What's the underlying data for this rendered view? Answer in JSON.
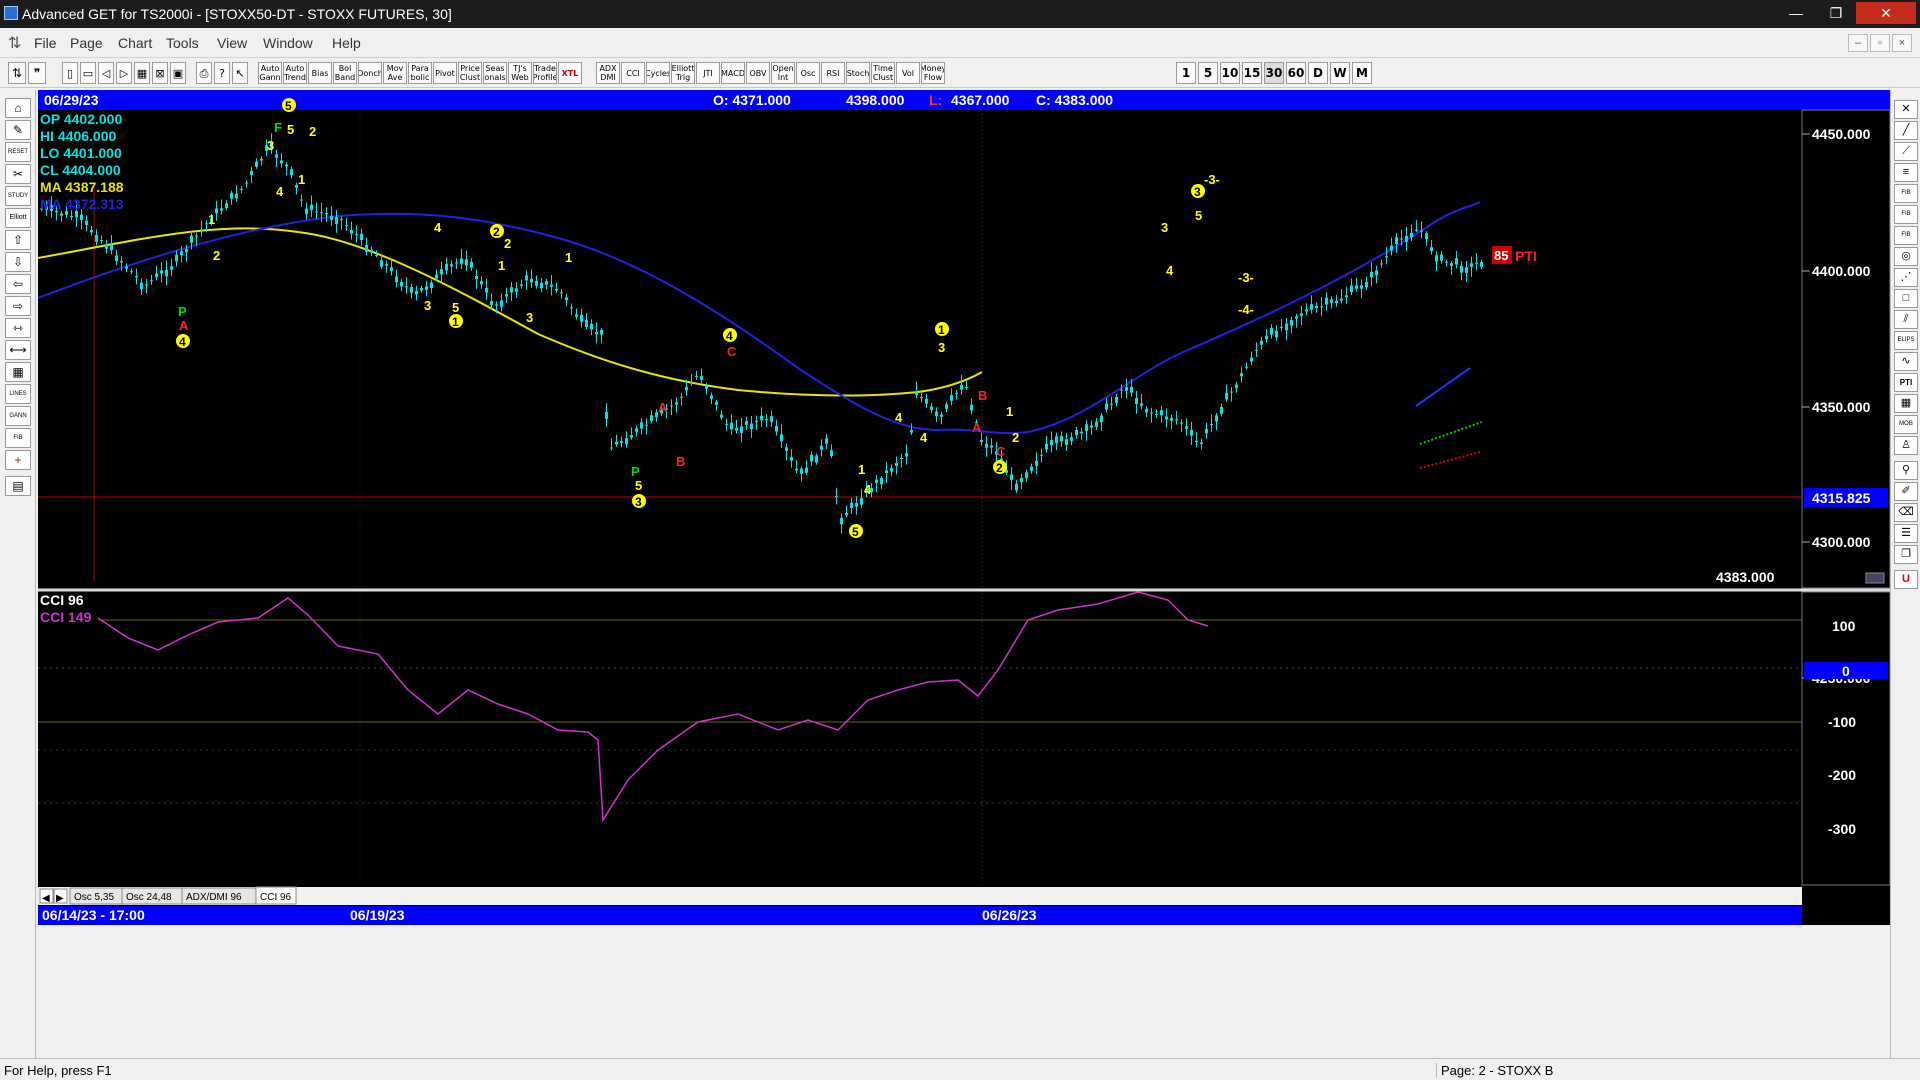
{
  "window": {
    "title": "Advanced GET for TS2000i - [STOXX50-DT - STOXX FUTURES, 30]",
    "buttons": [
      "—",
      "❐",
      "✕"
    ]
  },
  "menu": {
    "items": [
      "File",
      "Page",
      "Chart",
      "Tools",
      "View",
      "Window",
      "Help"
    ],
    "mdi_buttons": [
      "–",
      "▫",
      "×"
    ]
  },
  "toolbar": {
    "study_buttons": [
      "Auto Gann",
      "Auto Trend",
      "Bias",
      "Bol Band",
      "Donch",
      "Mov Ave",
      "Para bolic",
      "Pivot",
      "Price Clust",
      "Seas onals",
      "TJ's Web",
      "Trade Profile",
      "XTL",
      "ADX DMI",
      "CCI",
      "Cycles",
      "Elliott Trig",
      "JTI",
      "MACD",
      "OBV",
      "Open Int",
      "Osc",
      "RSI",
      "Stoch",
      "Time Clust",
      "Vol",
      "Money Flow"
    ],
    "interval_buttons": [
      "1",
      "5",
      "10",
      "15",
      "30",
      "60",
      "D",
      "W",
      "M"
    ]
  },
  "header": {
    "date": "06/29/23",
    "ohlc_open": "O: 4371.000",
    "ohlc_high": "4398.000",
    "ohlc_low_prefix": "L:",
    "ohlc_low": "4367.000",
    "ohlc_close": "C: 4383.000"
  },
  "legend": {
    "op": "OP  4402.000",
    "hi": "HI   4406.000",
    "lo": "LO  4401.000",
    "cl": "CL  4404.000",
    "ma1": "MA  4387.188",
    "ma2": "MA  4372.313"
  },
  "price_axis": {
    "ticks": [
      "4450.000",
      "4400.000",
      "4350.000",
      "4300.000",
      "4250.000"
    ],
    "current_line": "4315.825",
    "last_price": "4383.000"
  },
  "pti": {
    "value": "85",
    "label": "PTI"
  },
  "elliott_labels": {
    "wave_counts": [
      "5",
      "5",
      "2",
      "3",
      "4",
      "1",
      "1",
      "2",
      "4",
      "2",
      "1",
      "3",
      "5",
      "1",
      "4",
      "3",
      "3",
      "4",
      "5",
      "1",
      "4",
      "3",
      "5",
      "1",
      "2",
      "3",
      "4",
      "1",
      "2",
      "3",
      "5",
      "4",
      "-3-",
      "-3-",
      "-4-"
    ],
    "circled": [
      "5",
      "4",
      "2",
      "1",
      "4",
      "3",
      "1",
      "5",
      "2",
      "3"
    ],
    "abc": [
      "A",
      "B",
      "C",
      "C",
      "A",
      "B",
      "C",
      "P",
      "P",
      "P",
      "F"
    ]
  },
  "oscillator": {
    "title": "CCI 96",
    "value_label": "CCI  149",
    "ticks": [
      "100",
      "0",
      "-100",
      "-200",
      "-300"
    ],
    "zero_label": "0"
  },
  "tabs": [
    "Osc 5,35",
    "Osc 24,48",
    "ADX/DMI 96",
    "CCI 96"
  ],
  "time_axis": [
    "06/14/23 - 17:00",
    "06/19/23",
    "06/26/23"
  ],
  "status": {
    "help": "For Help, press F1",
    "page": "Page: 2 - STOXX B"
  },
  "colors": {
    "background": "#000000",
    "blue_bar": "#0000ff",
    "candle": "#00e5e5",
    "ma_yellow": "#e6e600",
    "ma_blue": "#2222dd",
    "cci": "#cc33cc",
    "label_yellow": "#ffff00",
    "label_red": "#ff2020",
    "label_green": "#00dd00"
  }
}
